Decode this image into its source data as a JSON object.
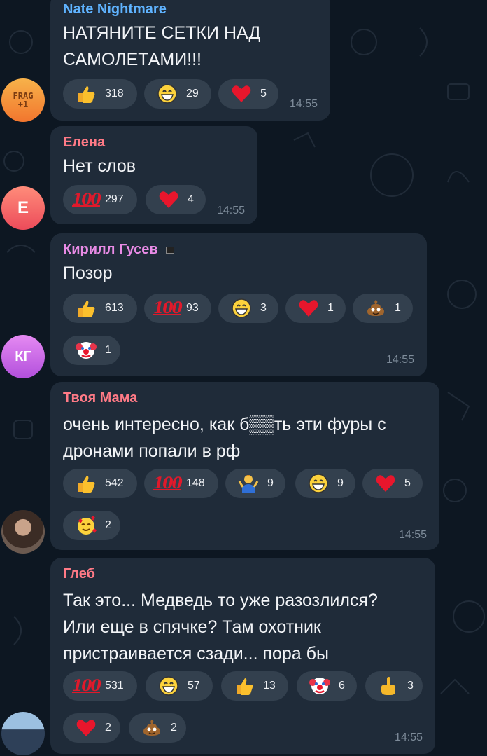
{
  "messages": [
    {
      "name": "Nate Nightmare",
      "name_color": "#5fb3ff",
      "text": [
        "НАТЯНИТЕ СЕТКИ НАД",
        "САМОЛЕТАМИ!!!"
      ],
      "time": "14:55",
      "reactions": [
        {
          "icon": "thumbs-up",
          "count": "318"
        },
        {
          "icon": "grinning",
          "count": "29"
        },
        {
          "icon": "heart",
          "count": "5"
        }
      ],
      "avatar": {
        "label": "FRAG +1",
        "colors": [
          "#f7b24a",
          "#f2762e"
        ]
      }
    },
    {
      "name": "Елена",
      "name_color": "#ff7a86",
      "text": [
        "Нет слов"
      ],
      "time": "14:55",
      "reactions": [
        {
          "icon": "hundred",
          "count": "297"
        },
        {
          "icon": "heart",
          "count": "4"
        }
      ],
      "avatar": {
        "label": "Е",
        "colors": [
          "#ff8c7a",
          "#ec4b5a"
        ]
      }
    },
    {
      "name": "Кирилл Гусев",
      "name_color": "#e98be6",
      "text": [
        "Позор"
      ],
      "time": "14:55",
      "name_badge": "flag",
      "reactions": [
        {
          "icon": "thumbs-up",
          "count": "613"
        },
        {
          "icon": "hundred",
          "count": "93"
        },
        {
          "icon": "grinning",
          "count": "3"
        },
        {
          "icon": "heart",
          "count": "1"
        },
        {
          "icon": "poop",
          "count": "1"
        },
        {
          "icon": "clown",
          "count": "1"
        }
      ],
      "avatar": {
        "label": "КГ",
        "colors": [
          "#e58af2",
          "#b24fdc"
        ]
      }
    },
    {
      "name": "Твоя Мама",
      "name_color": "#ff7a86",
      "text": [
        "очень интересно, как б▒▒ть эти фуры с",
        "дронами попали в рф"
      ],
      "time": "14:55",
      "reactions": [
        {
          "icon": "thumbs-up",
          "count": "542"
        },
        {
          "icon": "hundred",
          "count": "148"
        },
        {
          "icon": "shrug",
          "count": "9"
        },
        {
          "icon": "grinning",
          "count": "9"
        },
        {
          "icon": "heart",
          "count": "5"
        },
        {
          "icon": "smiling-hearts",
          "count": "2"
        }
      ],
      "avatar": {
        "label": "",
        "colors": [
          "#6b5a50",
          "#2a221e"
        ]
      }
    },
    {
      "name": "Глеб",
      "name_color": "#ff7a86",
      "text": [
        "Так это... Медведь то уже разозлился?",
        "Или еще в спячке? Там охотник",
        "пристраивается сзади... пора бы"
      ],
      "time": "14:55",
      "reactions": [
        {
          "icon": "hundred",
          "count": "531"
        },
        {
          "icon": "grinning",
          "count": "57"
        },
        {
          "icon": "thumbs-up",
          "count": "13"
        },
        {
          "icon": "clown",
          "count": "6"
        },
        {
          "icon": "middle-finger",
          "count": "3"
        },
        {
          "icon": "heart",
          "count": "2"
        },
        {
          "icon": "poop",
          "count": "2"
        }
      ],
      "avatar": {
        "label": "",
        "colors": [
          "#8aa9c8",
          "#33475e"
        ]
      }
    }
  ]
}
